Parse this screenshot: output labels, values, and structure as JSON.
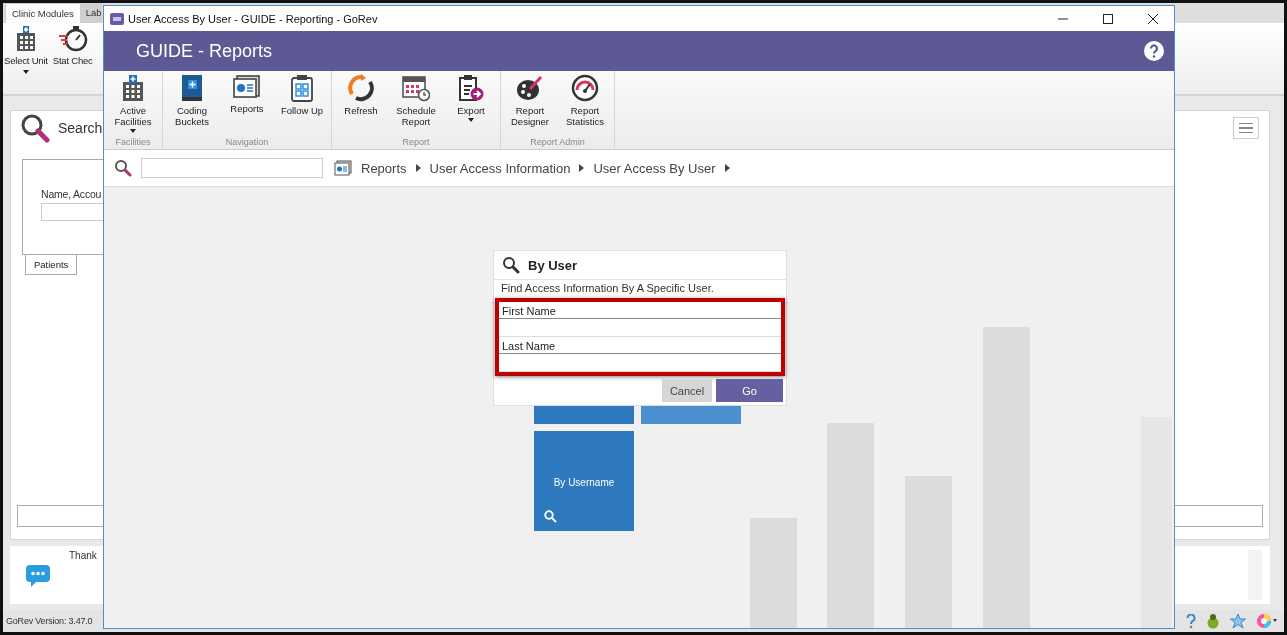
{
  "background_app": {
    "tabs": [
      {
        "label": "Clinic Modules",
        "selected": true
      },
      {
        "label": "Lab",
        "selected": false
      }
    ],
    "ribbon": [
      {
        "label": "Select Unit",
        "dropdown": true
      },
      {
        "label": "Stat Chec",
        "dropdown": false
      }
    ],
    "search_panel": {
      "title": "Search",
      "field_label": "Name, Accou",
      "tabs": [
        {
          "label": "Patients",
          "selected": true
        }
      ]
    },
    "message": {
      "text": "Thank"
    },
    "status_bar": {
      "version": "GoRev Version: 3.47.0"
    }
  },
  "window": {
    "title": "User Access By User - GUIDE - Reporting - GoRev",
    "header": "GUIDE - Reports",
    "ribbon_groups": [
      {
        "name": "Facilities",
        "buttons": [
          {
            "label": "Active Facilities",
            "dropdown": true
          }
        ]
      },
      {
        "name": "Navigation",
        "buttons": [
          {
            "label": "Coding Buckets",
            "dropdown": false
          },
          {
            "label": "Reports",
            "dropdown": false
          },
          {
            "label": "Follow Up",
            "dropdown": false
          }
        ]
      },
      {
        "name": "Report",
        "buttons": [
          {
            "label": "Refresh",
            "dropdown": false
          },
          {
            "label": "Schedule Report",
            "dropdown": false
          },
          {
            "label": "Export",
            "dropdown": true
          }
        ]
      },
      {
        "name": "Report Admin",
        "buttons": [
          {
            "label": "Report Designer",
            "dropdown": false
          },
          {
            "label": "Report Statistics",
            "dropdown": false
          }
        ]
      }
    ],
    "breadcrumb": [
      "Reports",
      "User Access Information",
      "User Access By User"
    ],
    "tiles": [
      {
        "label": "By Username"
      }
    ],
    "dialog": {
      "title": "By User",
      "description": "Find Access Information By A Specific User.",
      "highlighted": true,
      "fields": [
        {
          "label": "First Name"
        },
        {
          "label": "Last Name"
        }
      ],
      "buttons": [
        {
          "label": "Cancel",
          "kind": "secondary"
        },
        {
          "label": "Go",
          "kind": "primary"
        }
      ]
    }
  }
}
